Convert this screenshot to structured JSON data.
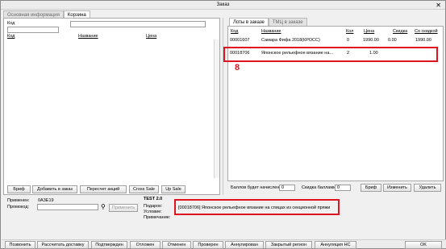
{
  "window": {
    "title": "Заказ",
    "close": "✕"
  },
  "left": {
    "tabs": [
      {
        "label": "Основная информация"
      },
      {
        "label": "Корзина"
      }
    ],
    "search_label": "Код",
    "columns": {
      "code": "Код",
      "name": "Название",
      "price": "Цена"
    },
    "buttons": {
      "brief": "Бриф",
      "add": "Добавить в заказ",
      "recalc": "Пересчет акций",
      "cross": "Cross Sale",
      "up": "Up Sale"
    }
  },
  "right": {
    "tabs": [
      {
        "label": "Лоты в заказе"
      },
      {
        "label": "ТМЦ в заказе"
      }
    ],
    "columns": {
      "code": "Код",
      "name": "Название",
      "qty": "Кол",
      "price": "Цена",
      "discount": "Скидка",
      "with_discount": "Со скидкой"
    },
    "rows": [
      {
        "code": "00001607",
        "name": "Самара Фифа 2018(КРОСС)",
        "qty": "0",
        "price": "1990.00",
        "discount": "0.00",
        "with_discount": "1990.00"
      },
      {
        "code": "00018706",
        "name": "Японское рельефное вязание на...",
        "qty": "2",
        "price": "1.00",
        "discount": "",
        "with_discount": ""
      }
    ],
    "annotation_number": "8",
    "bonus_label": "Баллов будет начислено",
    "bonus_value": "0",
    "discount_points_label": "Скидка баллами",
    "discount_points_value": "0",
    "buttons": {
      "brief": "Бриф",
      "change": "Изменить",
      "delete": "Удалить"
    }
  },
  "info": {
    "applied_label": "Применен:",
    "applied_value": "0A3E19",
    "promo_label": "Промокод:",
    "promo_value": "",
    "search_icon": "⚲",
    "apply_button": "Применить",
    "test_title": "TEST 2.0",
    "gift_label": "Подарок:",
    "condition_label": "Условие:",
    "note_label": "Примечание:",
    "gift_text": "[00018706] Японское рельефное вязание на спицах из секционной пряжи"
  },
  "actions": [
    "Позвонить",
    "Рассчитать доставку",
    "Подтвержден",
    "Отложен",
    "Отменен",
    "Проверен",
    "Аннулирован",
    "Закрытый регион",
    "Аннуляция НС"
  ],
  "ok_button": "OK",
  "accent_red": "#e0141e"
}
